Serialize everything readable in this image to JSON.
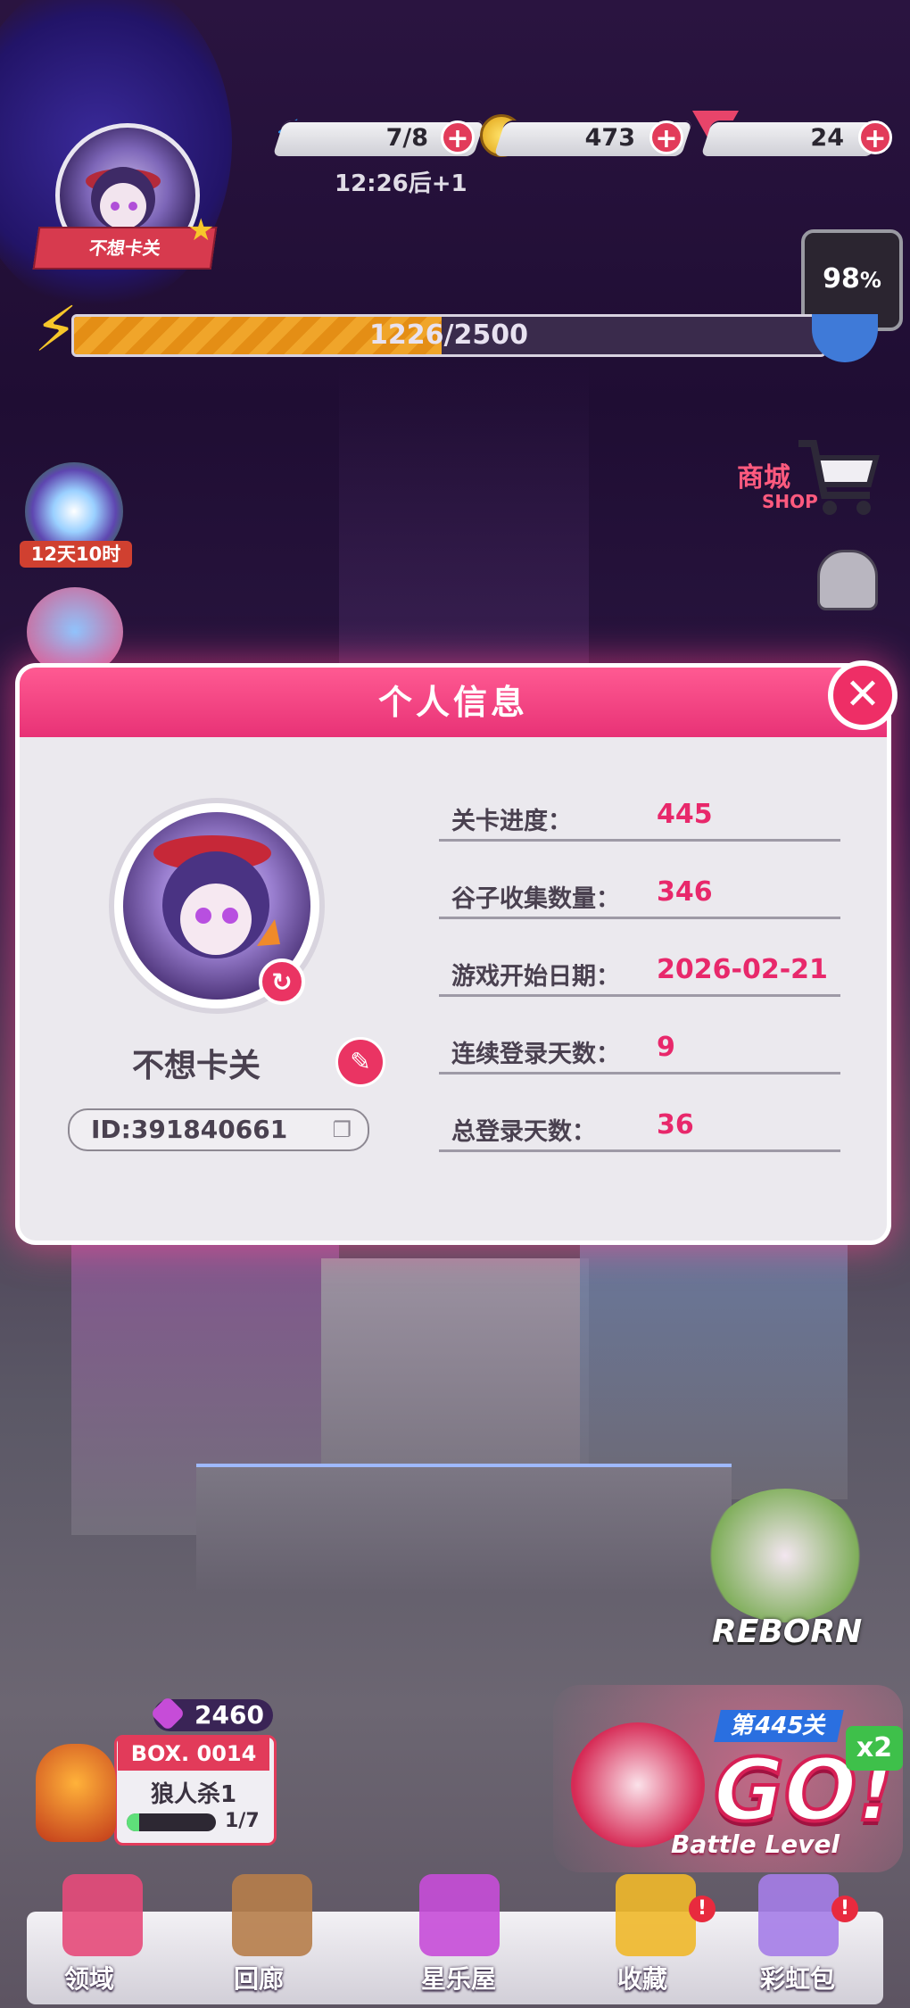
{
  "resources": {
    "energy": {
      "value": "7/8",
      "icon": "lightning-icon"
    },
    "coins": {
      "value": "473",
      "icon": "coin-icon"
    },
    "gems": {
      "value": "24",
      "icon": "gem-icon"
    },
    "plus_label": "+",
    "energy_timer": "12:26后+1"
  },
  "player_badge": {
    "name": "不想卡关"
  },
  "progress": {
    "text": "1226/2500",
    "fraction": 0.4904
  },
  "completion": {
    "value": "98",
    "unit": "%"
  },
  "side": {
    "event_timer": "12天10时",
    "shop_label": "商城",
    "shop_sub": "SHOP"
  },
  "profile_modal": {
    "title": "个人信息",
    "close_icon": "✕",
    "name": "不想卡关",
    "id": "ID:391840661",
    "rows": [
      {
        "label": "关卡进度：",
        "value": "445"
      },
      {
        "label": "谷子收集数量：",
        "value": "346"
      },
      {
        "label": "游戏开始日期：",
        "value": "2026-02-21"
      },
      {
        "label": "连续登录天数：",
        "value": "9"
      },
      {
        "label": "总登录天数：",
        "value": "36"
      }
    ]
  },
  "box_card": {
    "points": "2460",
    "box_no": "BOX. 0014",
    "name": "狼人杀1",
    "progress": "1/7",
    "fraction": 0.14
  },
  "level_button": {
    "level": "第445关",
    "go": "GO!",
    "mode": "Battle Level",
    "multiplier": "x2",
    "reborn": "REBORN"
  },
  "dock": [
    {
      "label": "领域",
      "icon": "territory-icon"
    },
    {
      "label": "回廊",
      "icon": "gallery-icon"
    },
    {
      "label": "星乐屋",
      "icon": "star-house-icon"
    },
    {
      "label": "收藏",
      "icon": "star-icon",
      "badge": "!"
    },
    {
      "label": "彩虹包",
      "icon": "rainbow-pack-icon",
      "badge": "!"
    }
  ],
  "colors": {
    "accent": "#e8286b",
    "header": "#ff5a92",
    "panel": "#ebe9ee"
  }
}
